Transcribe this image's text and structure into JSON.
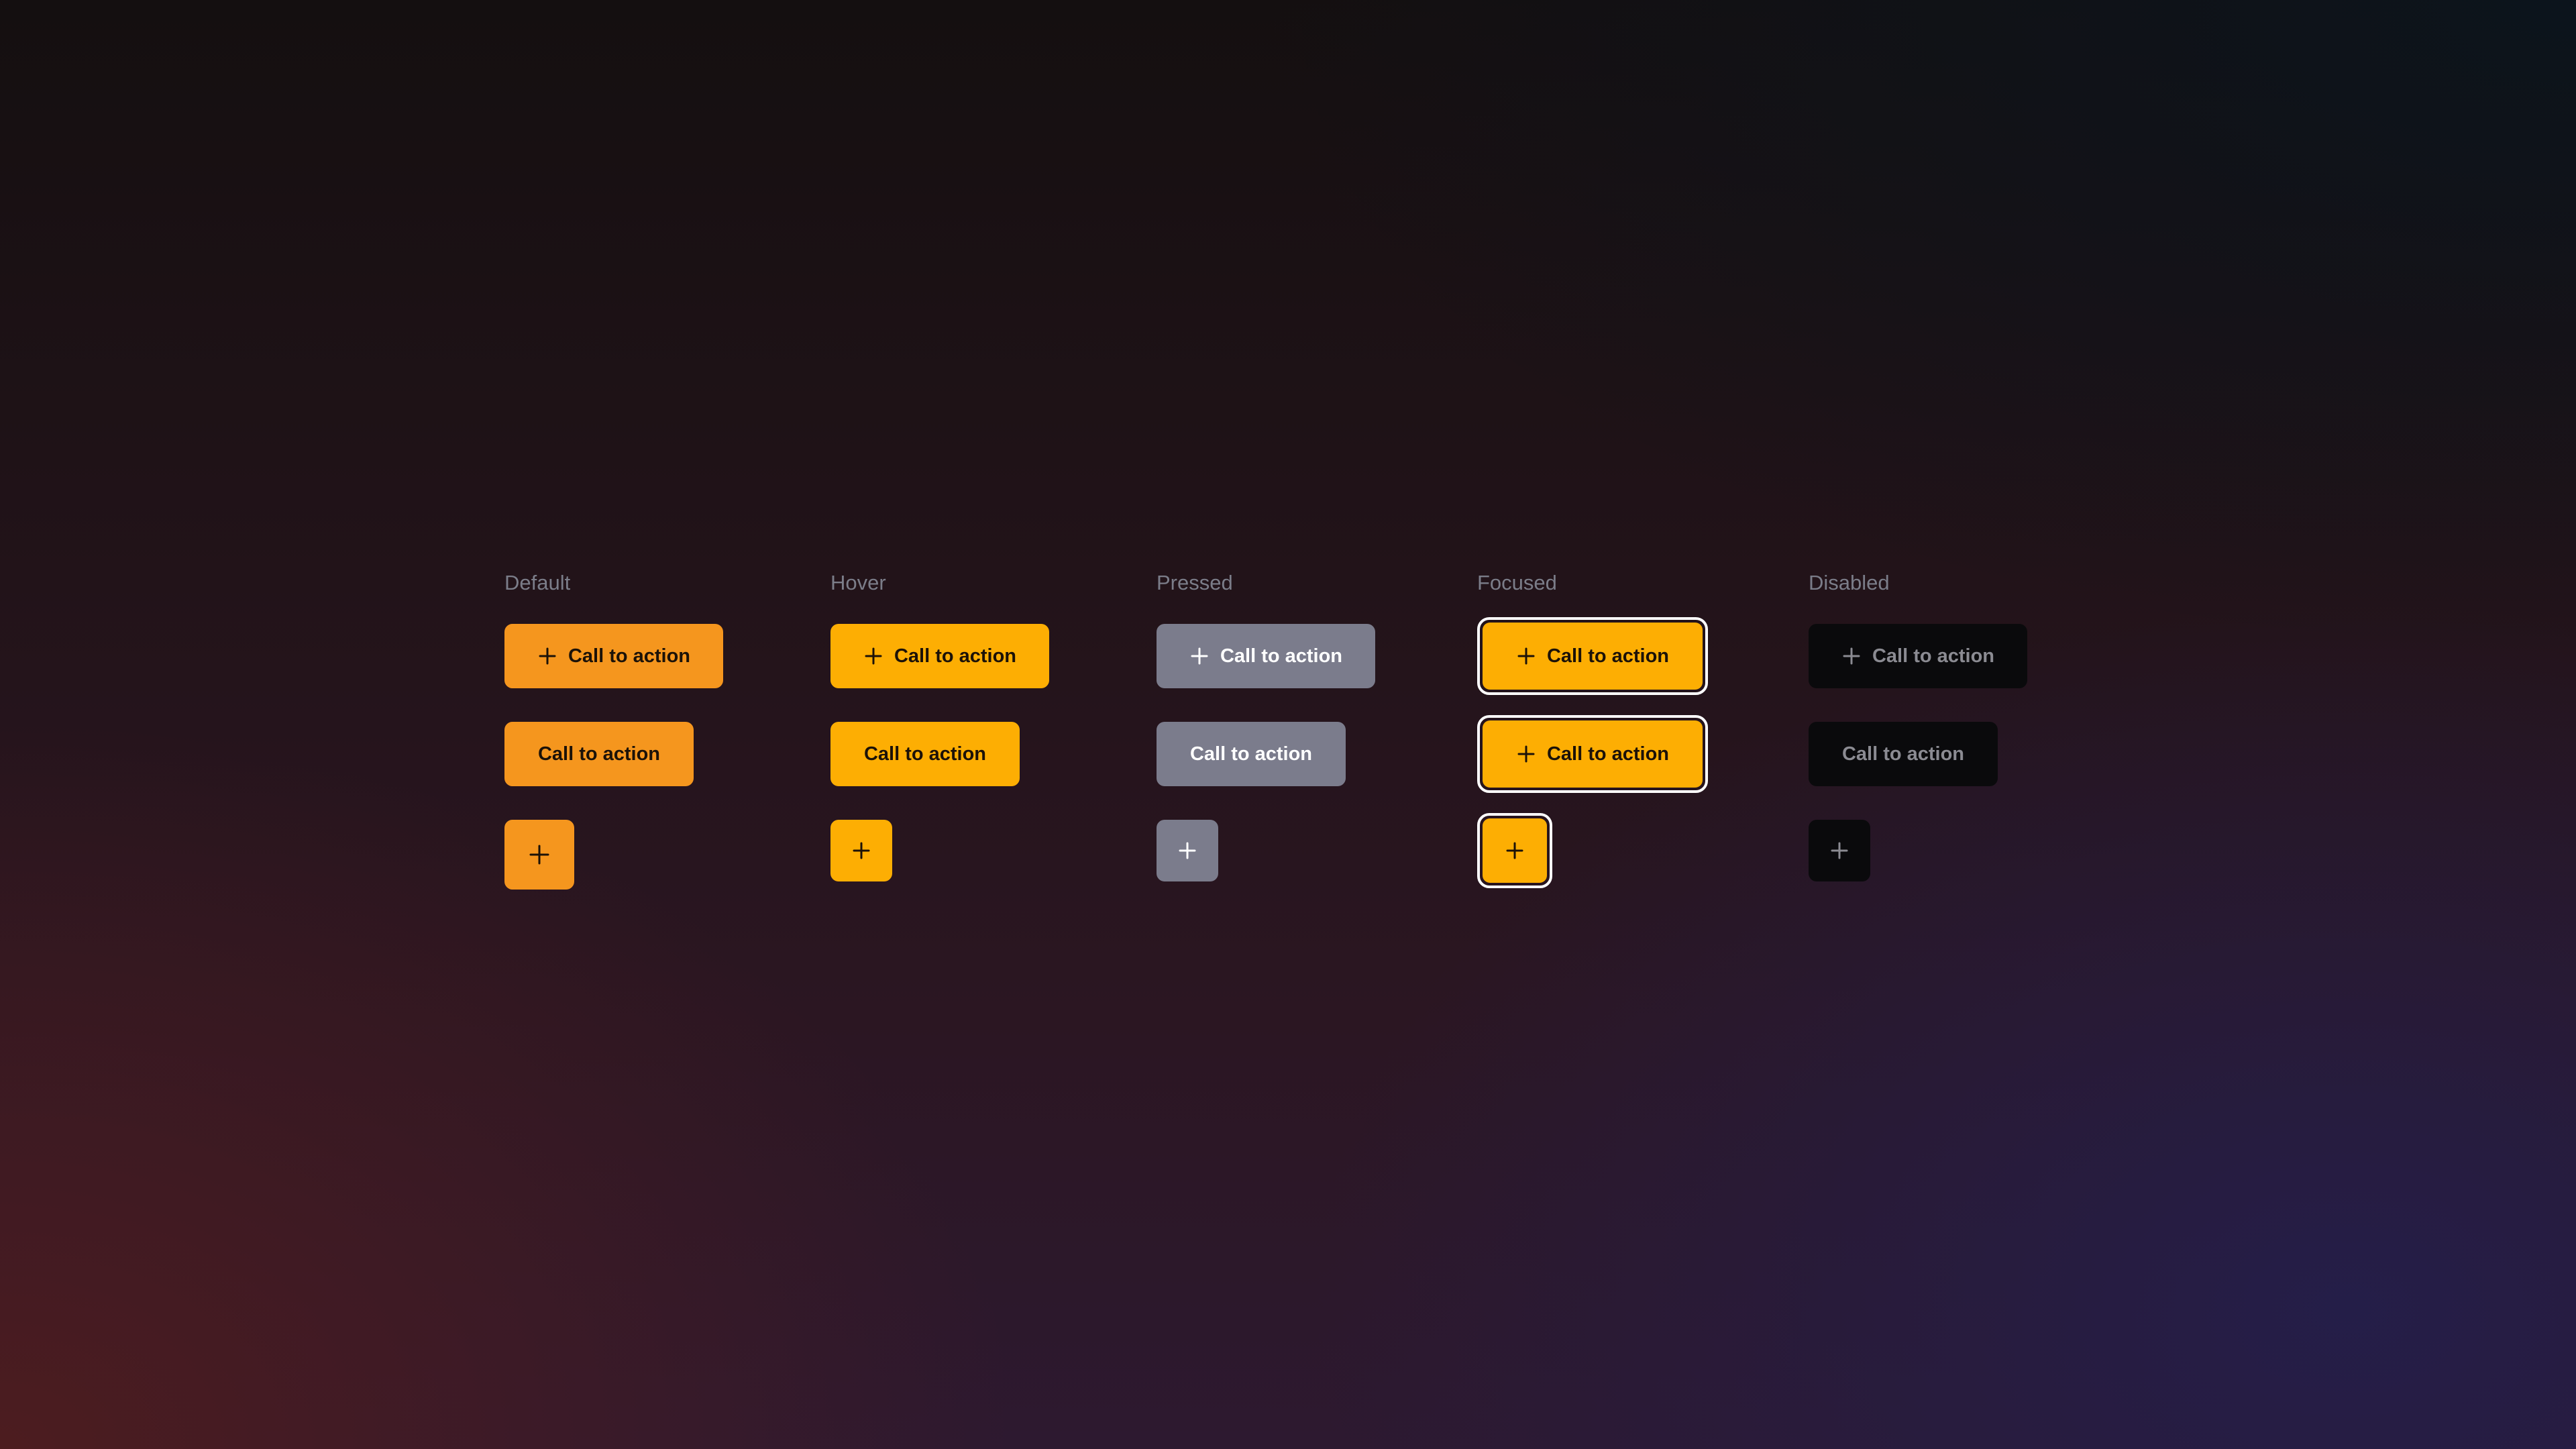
{
  "columns": {
    "default": {
      "label": "Default"
    },
    "hover": {
      "label": "Hover"
    },
    "pressed": {
      "label": "Pressed"
    },
    "focused": {
      "label": "Focused"
    },
    "disabled": {
      "label": "Disabled"
    }
  },
  "button": {
    "label": "Call to action",
    "icon": "plus-icon"
  },
  "colors": {
    "default_fill": "#f5961e",
    "hover_fill": "#fdae03",
    "pressed_fill": "#7b7c8c",
    "focused_fill": "#fdae03",
    "focus_ring": "#ffffff",
    "disabled_fill": "#0a0a0c",
    "label_gray": "#7b7d89"
  }
}
